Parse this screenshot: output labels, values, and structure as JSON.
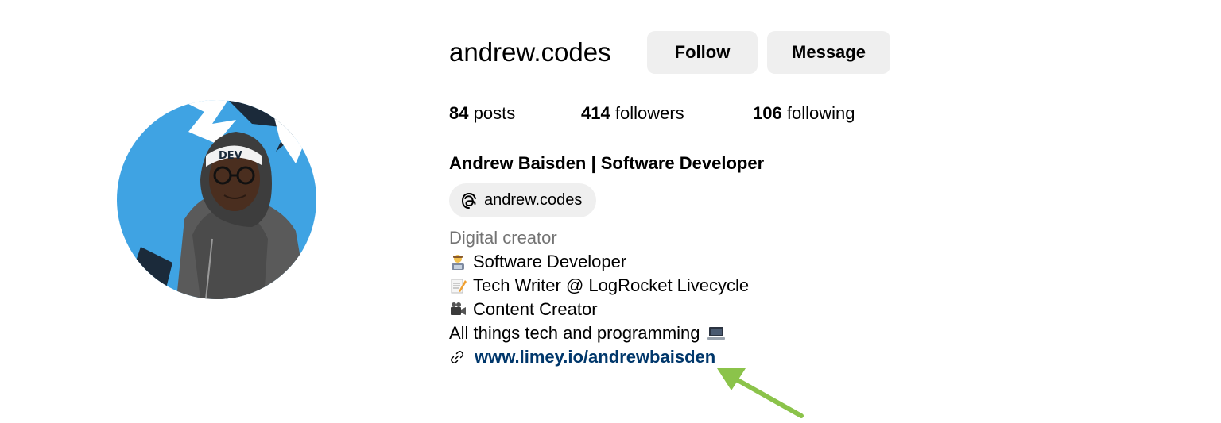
{
  "profile": {
    "username": "andrew.codes",
    "follow_label": "Follow",
    "message_label": "Message",
    "stats": {
      "posts_count": "84",
      "posts_label": "posts",
      "followers_count": "414",
      "followers_label": "followers",
      "following_count": "106",
      "following_label": "following"
    },
    "full_name": "Andrew Baisden | Software Developer",
    "threads_handle": "andrew.codes",
    "category": "Digital creator",
    "bio_lines": [
      {
        "emoji": "technologist-emoji",
        "text": "Software Developer"
      },
      {
        "emoji": "memo-emoji",
        "text": "Tech Writer @ LogRocket Livecycle"
      },
      {
        "emoji": "video-camera-emoji",
        "text": "Content Creator"
      },
      {
        "text": "All things tech and programming",
        "emoji_after": "laptop-emoji"
      }
    ],
    "link_icon": "link-icon",
    "link_url": "www.limey.io/andrewbaisden"
  },
  "colors": {
    "button_bg": "#efefef",
    "link": "#00376b",
    "category_text": "#737373",
    "avatar_bg": "#3fa3e3",
    "annotation_arrow": "#8bc34a"
  }
}
